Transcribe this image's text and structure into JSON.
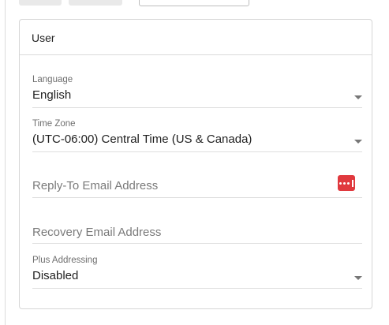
{
  "card": {
    "title": "User"
  },
  "fields": {
    "language": {
      "label": "Language",
      "value": "English",
      "icon": "chevron-down-icon"
    },
    "time_zone": {
      "label": "Time Zone",
      "value": "(UTC-06:00) Central Time (US & Canada)",
      "icon": "chevron-down-icon"
    },
    "reply_to_email": {
      "placeholder": "Reply-To Email Address",
      "value": "",
      "icon": "password-manager-icon",
      "icon_color": "#e0393e"
    },
    "recovery_email": {
      "placeholder": "Recovery Email Address",
      "value": ""
    },
    "plus_addressing": {
      "label": "Plus Addressing",
      "value": "Disabled",
      "icon": "chevron-down-icon"
    }
  }
}
